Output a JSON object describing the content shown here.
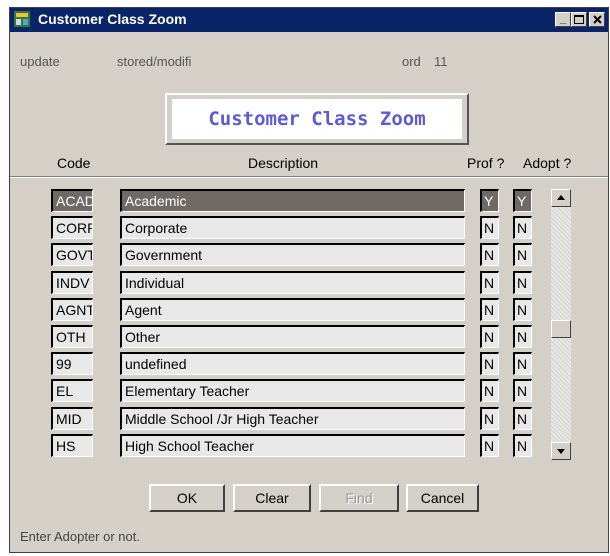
{
  "window": {
    "title": "Customer Class Zoom"
  },
  "info": {
    "mode": "update",
    "state": "stored/modifi",
    "ord_label": "ord",
    "ord_value": "11"
  },
  "banner": "Customer Class Zoom",
  "columns": {
    "code": "Code",
    "description": "Description",
    "prof": "Prof ?",
    "adopt": "Adopt ?"
  },
  "rows": [
    {
      "code": "ACAD",
      "description": "Academic",
      "prof": "Y",
      "adopt": "Y"
    },
    {
      "code": "CORP",
      "description": "Corporate",
      "prof": "N",
      "adopt": "N"
    },
    {
      "code": "GOVT",
      "description": "Government",
      "prof": "N",
      "adopt": "N"
    },
    {
      "code": "INDV",
      "description": "Individual",
      "prof": "N",
      "adopt": "N"
    },
    {
      "code": "AGNT",
      "description": "Agent",
      "prof": "N",
      "adopt": "N"
    },
    {
      "code": "OTH",
      "description": "Other",
      "prof": "N",
      "adopt": "N"
    },
    {
      "code": "99",
      "description": "undefined",
      "prof": "N",
      "adopt": "N"
    },
    {
      "code": "EL",
      "description": "Elementary Teacher",
      "prof": "N",
      "adopt": "N"
    },
    {
      "code": "MID",
      "description": "Middle School /Jr High Teacher",
      "prof": "N",
      "adopt": "N"
    },
    {
      "code": "HS",
      "description": "High School Teacher",
      "prof": "N",
      "adopt": "N"
    }
  ],
  "selected_row": 0,
  "buttons": {
    "ok": "OK",
    "clear": "Clear",
    "find": "Find",
    "cancel": "Cancel"
  },
  "status": "Enter Adopter or not.",
  "icons": {
    "window": "window-app-icon",
    "minimize": "minimize-icon",
    "maximize": "maximize-icon",
    "close": "close-icon",
    "scroll_up": "scroll-up-arrow-icon",
    "scroll_down": "scroll-down-arrow-icon"
  },
  "colors": {
    "titlebar": "#0a246a",
    "banner_text": "#5b5bd6",
    "selected_row": "#6f6a66"
  }
}
